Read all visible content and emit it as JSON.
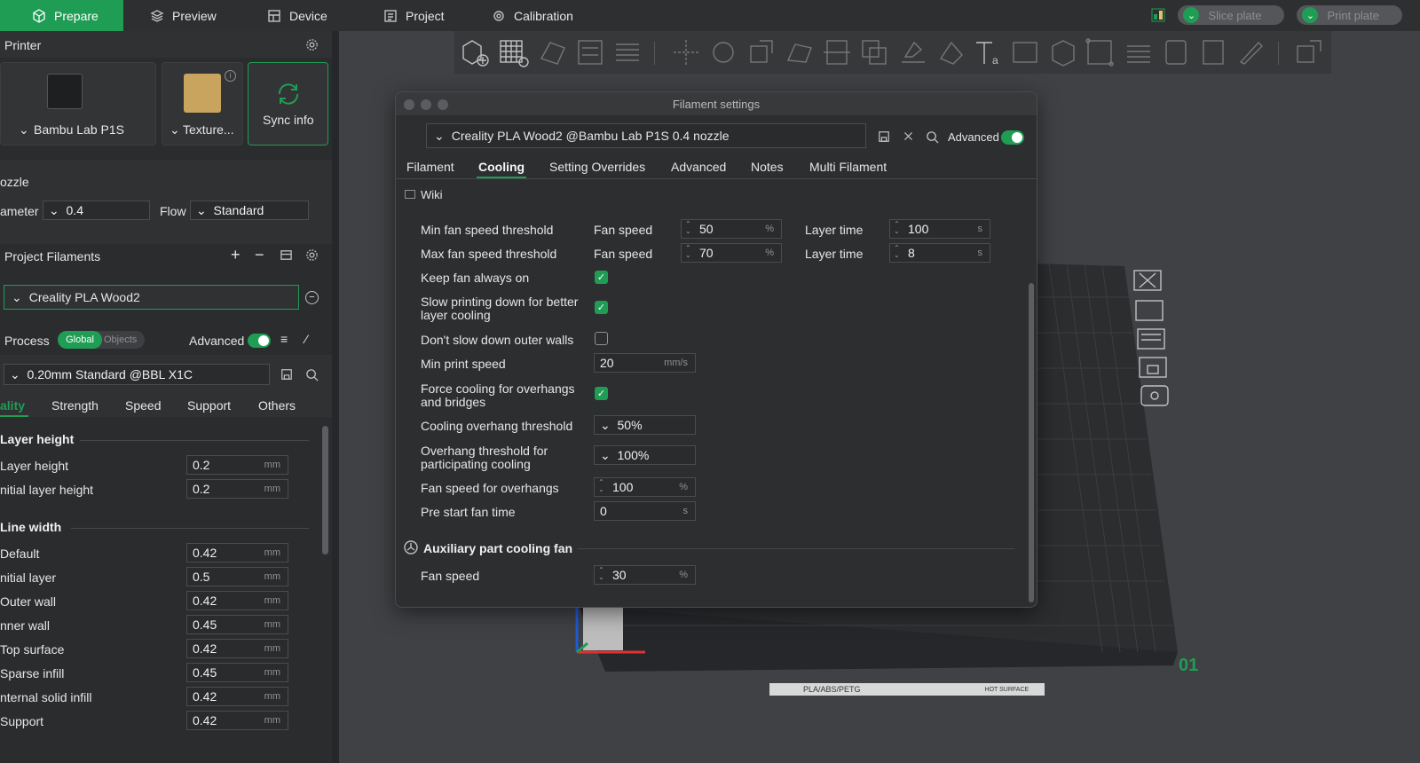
{
  "topbar": {
    "tabs": [
      {
        "label": "Prepare"
      },
      {
        "label": "Preview"
      },
      {
        "label": "Device"
      },
      {
        "label": "Project"
      },
      {
        "label": "Calibration"
      }
    ],
    "slice_label": "Slice plate",
    "print_label": "Print plate"
  },
  "printer": {
    "title": "Printer",
    "model": "Bambu Lab P1S",
    "plate": "Texture...",
    "sync": "Sync info",
    "nozzle_label": "ozzle",
    "diameter_label": "ameter",
    "diameter": "0.4",
    "flow_label": "Flow",
    "flow": "Standard"
  },
  "filaments": {
    "title": "Project Filaments",
    "item": "Creality PLA Wood2"
  },
  "process": {
    "title": "Process",
    "global": "Global",
    "objects": "Objects",
    "advanced": "Advanced",
    "preset": "0.20mm Standard @BBL X1C",
    "tabs": [
      "ality",
      "Strength",
      "Speed",
      "Support",
      "Others"
    ],
    "layer_height_hdr": "Layer height",
    "layer_rows": [
      {
        "label": "Layer height",
        "value": "0.2",
        "unit": "mm"
      },
      {
        "label": "nitial layer height",
        "value": "0.2",
        "unit": "mm"
      }
    ],
    "line_width_hdr": "Line width",
    "line_rows": [
      {
        "label": "Default",
        "value": "0.42",
        "unit": "mm"
      },
      {
        "label": "nitial layer",
        "value": "0.5",
        "unit": "mm"
      },
      {
        "label": "Outer wall",
        "value": "0.42",
        "unit": "mm"
      },
      {
        "label": "nner wall",
        "value": "0.45",
        "unit": "mm"
      },
      {
        "label": "Top surface",
        "value": "0.42",
        "unit": "mm"
      },
      {
        "label": "Sparse infill",
        "value": "0.45",
        "unit": "mm"
      },
      {
        "label": "nternal solid infill",
        "value": "0.42",
        "unit": "mm"
      },
      {
        "label": "Support",
        "value": "0.42",
        "unit": "mm"
      }
    ]
  },
  "dialog": {
    "title": "Filament settings",
    "preset": "Creality PLA Wood2 @Bambu Lab P1S 0.4 nozzle",
    "advanced": "Advanced",
    "tabs": [
      "Filament",
      "Cooling",
      "Setting Overrides",
      "Advanced",
      "Notes",
      "Multi Filament"
    ],
    "wiki": "Wiki",
    "fan_speed_label": "Fan speed",
    "layer_time_label": "Layer time",
    "min_fan": {
      "label": "Min fan speed threshold",
      "fan": "50",
      "fan_unit": "%",
      "time": "100",
      "time_unit": "s"
    },
    "max_fan": {
      "label": "Max fan speed threshold",
      "fan": "70",
      "fan_unit": "%",
      "time": "8",
      "time_unit": "s"
    },
    "keep_fan": "Keep fan always on",
    "slow_down_1": "Slow printing down for better",
    "slow_down_2": "layer cooling",
    "dont_slow": "Don't slow down outer walls",
    "min_print_speed": {
      "label": "Min print speed",
      "value": "20",
      "unit": "mm/s"
    },
    "force_cool_1": "Force cooling for overhangs",
    "force_cool_2": "and bridges",
    "cool_overhang": {
      "label": "Cooling overhang threshold",
      "value": "50%"
    },
    "overhang_part_1": "Overhang threshold for",
    "overhang_part_2": "participating cooling",
    "overhang_part_value": "100%",
    "fan_overhang": {
      "label": "Fan speed for overhangs",
      "value": "100",
      "unit": "%"
    },
    "pre_start": {
      "label": "Pre start fan time",
      "value": "0",
      "unit": "s"
    },
    "aux_title": "Auxiliary part cooling fan",
    "aux_fan": {
      "label": "Fan speed",
      "value": "30",
      "unit": "%"
    }
  },
  "plate": {
    "label": "PLA/ABS/PETG",
    "surface": "HOT SURFACE",
    "number": "01"
  }
}
